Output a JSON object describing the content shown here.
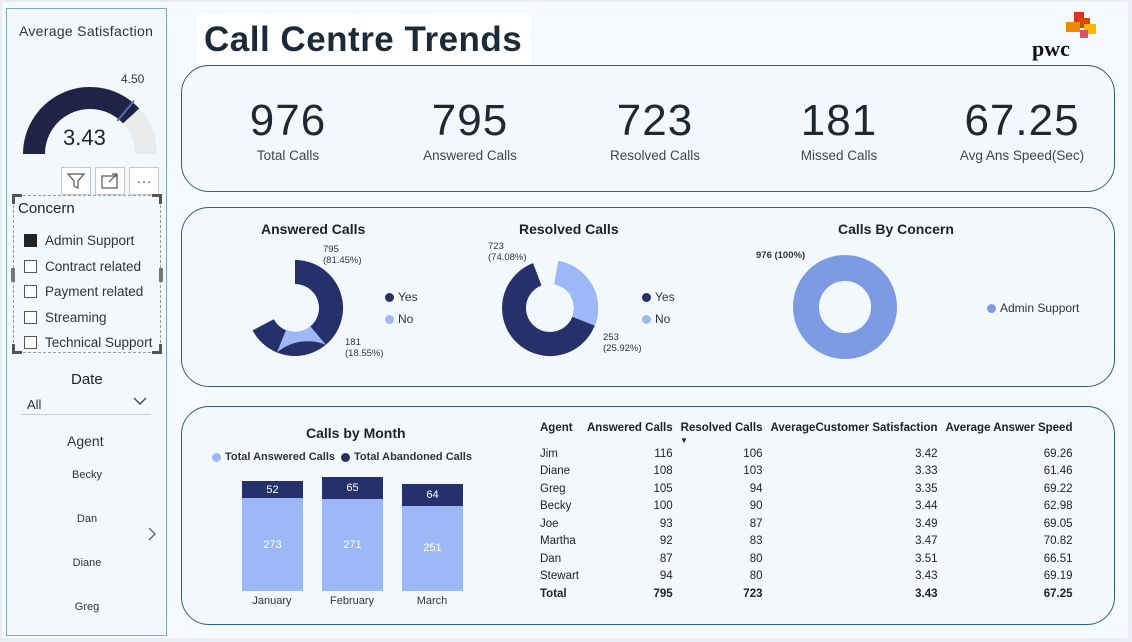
{
  "sidebar": {
    "satisfaction_title": "Average Satisfaction",
    "gauge": {
      "value": "3.43",
      "max_label": "4.50",
      "min": 0,
      "max": 4.5,
      "level": 3.43
    },
    "concern": {
      "title": "Concern",
      "items": [
        {
          "label": "Admin Support",
          "checked": true
        },
        {
          "label": "Contract related",
          "checked": false
        },
        {
          "label": "Payment related",
          "checked": false
        },
        {
          "label": "Streaming",
          "checked": false
        },
        {
          "label": "Technical Support",
          "checked": false
        }
      ]
    },
    "date": {
      "title": "Date",
      "selected": "All"
    },
    "agent": {
      "title": "Agent",
      "items": [
        "Becky",
        "Dan",
        "Diane",
        "Greg"
      ]
    }
  },
  "header": {
    "title": "Call Centre Trends",
    "logo_text": "pwc"
  },
  "kpis": [
    {
      "value": "976",
      "label": "Total Calls"
    },
    {
      "value": "795",
      "label": "Answered Calls"
    },
    {
      "value": "723",
      "label": "Resolved Calls"
    },
    {
      "value": "181",
      "label": "Missed Calls"
    },
    {
      "value": "67.25",
      "label": "Avg Ans Speed(Sec)"
    }
  ],
  "donuts": {
    "answered": {
      "title": "Answered Calls",
      "yes": {
        "label": "795",
        "pct": "(81.45%)"
      },
      "no": {
        "label": "181",
        "pct": "(18.55%)"
      },
      "legend": [
        "Yes",
        "No"
      ]
    },
    "resolved": {
      "title": "Resolved Calls",
      "yes": {
        "label": "723",
        "pct": "(74.08%)"
      },
      "no": {
        "label": "253",
        "pct": "(25.92%)"
      },
      "legend": [
        "Yes",
        "No"
      ]
    },
    "concern": {
      "title": "Calls By Concern",
      "label": "976 (100%)",
      "legend": [
        "Admin Support"
      ]
    }
  },
  "colors": {
    "dark": "#26306a",
    "light": "#9cb8f6",
    "concern": "#7d9be3",
    "border": "#2e5d8a"
  },
  "calls_by_month": {
    "title": "Calls by Month",
    "legend": [
      "Total Answered Calls",
      "Total Abandoned Calls"
    ]
  },
  "chart_data": {
    "type": "bar",
    "title": "Calls by Month",
    "categories": [
      "January",
      "February",
      "March"
    ],
    "series": [
      {
        "name": "Total Answered Calls",
        "values": [
          273,
          271,
          251
        ]
      },
      {
        "name": "Total Abandoned Calls",
        "values": [
          52,
          65,
          64
        ]
      }
    ],
    "stacked": true,
    "legend": "top"
  },
  "agent_table": {
    "headers": [
      "Agent",
      "Answered Calls",
      "Resolved Calls",
      "AverageCustomer Satisfaction",
      "Average Answer Speed"
    ],
    "rows": [
      [
        "Jim",
        "116",
        "106",
        "3.42",
        "69.26"
      ],
      [
        "Diane",
        "108",
        "103",
        "3.33",
        "61.46"
      ],
      [
        "Greg",
        "105",
        "94",
        "3.35",
        "69.22"
      ],
      [
        "Becky",
        "100",
        "90",
        "3.44",
        "62.98"
      ],
      [
        "Joe",
        "93",
        "87",
        "3.49",
        "69.05"
      ],
      [
        "Martha",
        "92",
        "83",
        "3.47",
        "70.82"
      ],
      [
        "Dan",
        "87",
        "80",
        "3.51",
        "66.51"
      ],
      [
        "Stewart",
        "94",
        "80",
        "3.43",
        "69.19"
      ]
    ],
    "total": [
      "Total",
      "795",
      "723",
      "3.43",
      "67.25"
    ]
  }
}
